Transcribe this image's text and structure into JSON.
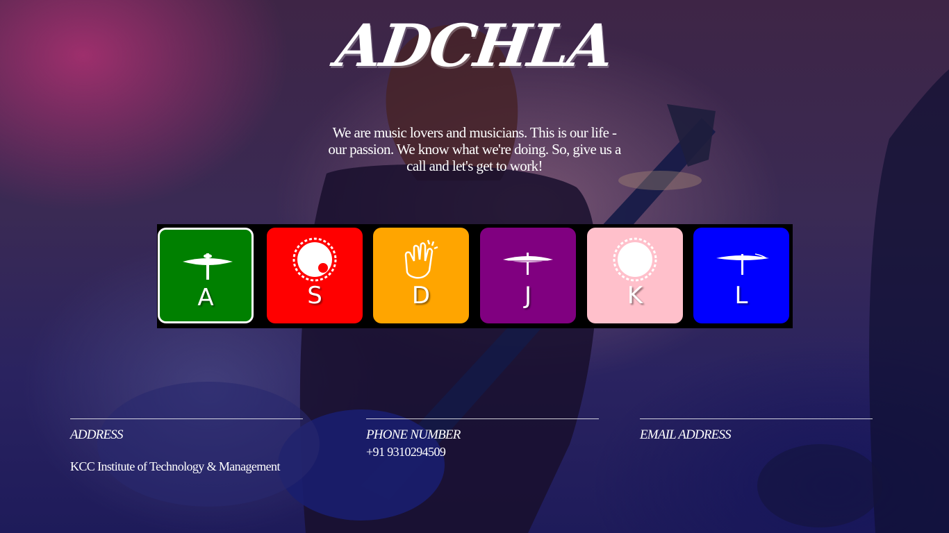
{
  "header": {
    "title": "ADCHLA",
    "tagline": "We are music lovers and musicians. This is our life - our passion. We know what we're doing. So, give us a call and let's get to work!"
  },
  "drum_pads": [
    {
      "key": "A",
      "icon": "hihat-icon",
      "color": "#008000",
      "active": true
    },
    {
      "key": "S",
      "icon": "snare-drum-icon",
      "color": "#ff0000",
      "active": false
    },
    {
      "key": "D",
      "icon": "clap-icon",
      "color": "#ffa500",
      "active": false
    },
    {
      "key": "J",
      "icon": "cymbal-icon",
      "color": "#800080",
      "active": false
    },
    {
      "key": "K",
      "icon": "drum-icon",
      "color": "#ffc0cb",
      "active": false
    },
    {
      "key": "L",
      "icon": "crash-cymbal-icon",
      "color": "#0000ff",
      "active": false
    }
  ],
  "footer": {
    "address": {
      "label": "ADDRESS",
      "value": "KCC Institute of Technology & Management"
    },
    "phone": {
      "label": "PHONE NUMBER",
      "value": "+91 9310294509"
    },
    "email": {
      "label": "EMAIL ADDRESS",
      "value": ""
    }
  }
}
